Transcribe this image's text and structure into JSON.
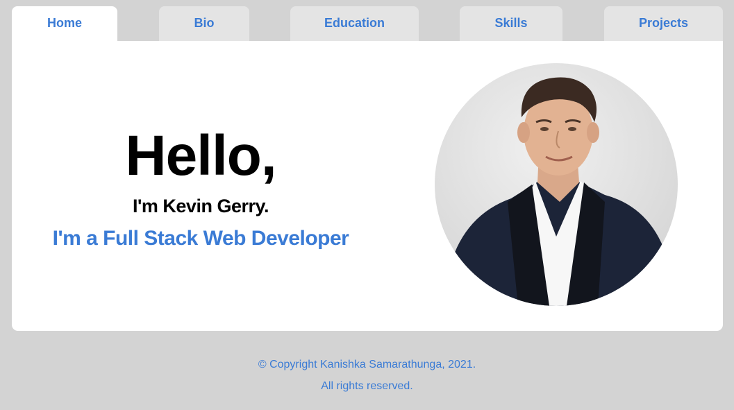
{
  "nav": {
    "tabs": [
      {
        "label": "Home",
        "active": true
      },
      {
        "label": "Bio",
        "active": false
      },
      {
        "label": "Education",
        "active": false
      },
      {
        "label": "Skills",
        "active": false
      },
      {
        "label": "Projects",
        "active": false
      }
    ]
  },
  "hero": {
    "greeting": "Hello,",
    "name_line": "I'm Kevin Gerry.",
    "role_line": "I'm a Full Stack Web Developer"
  },
  "footer": {
    "copyright": "© Copyright Kanishka Samarathunga, 2021.",
    "rights": "All rights reserved."
  },
  "colors": {
    "accent": "#3a7bd5",
    "background": "#d3d3d3",
    "panel": "#ffffff",
    "inactive_tab": "#e4e4e4"
  }
}
